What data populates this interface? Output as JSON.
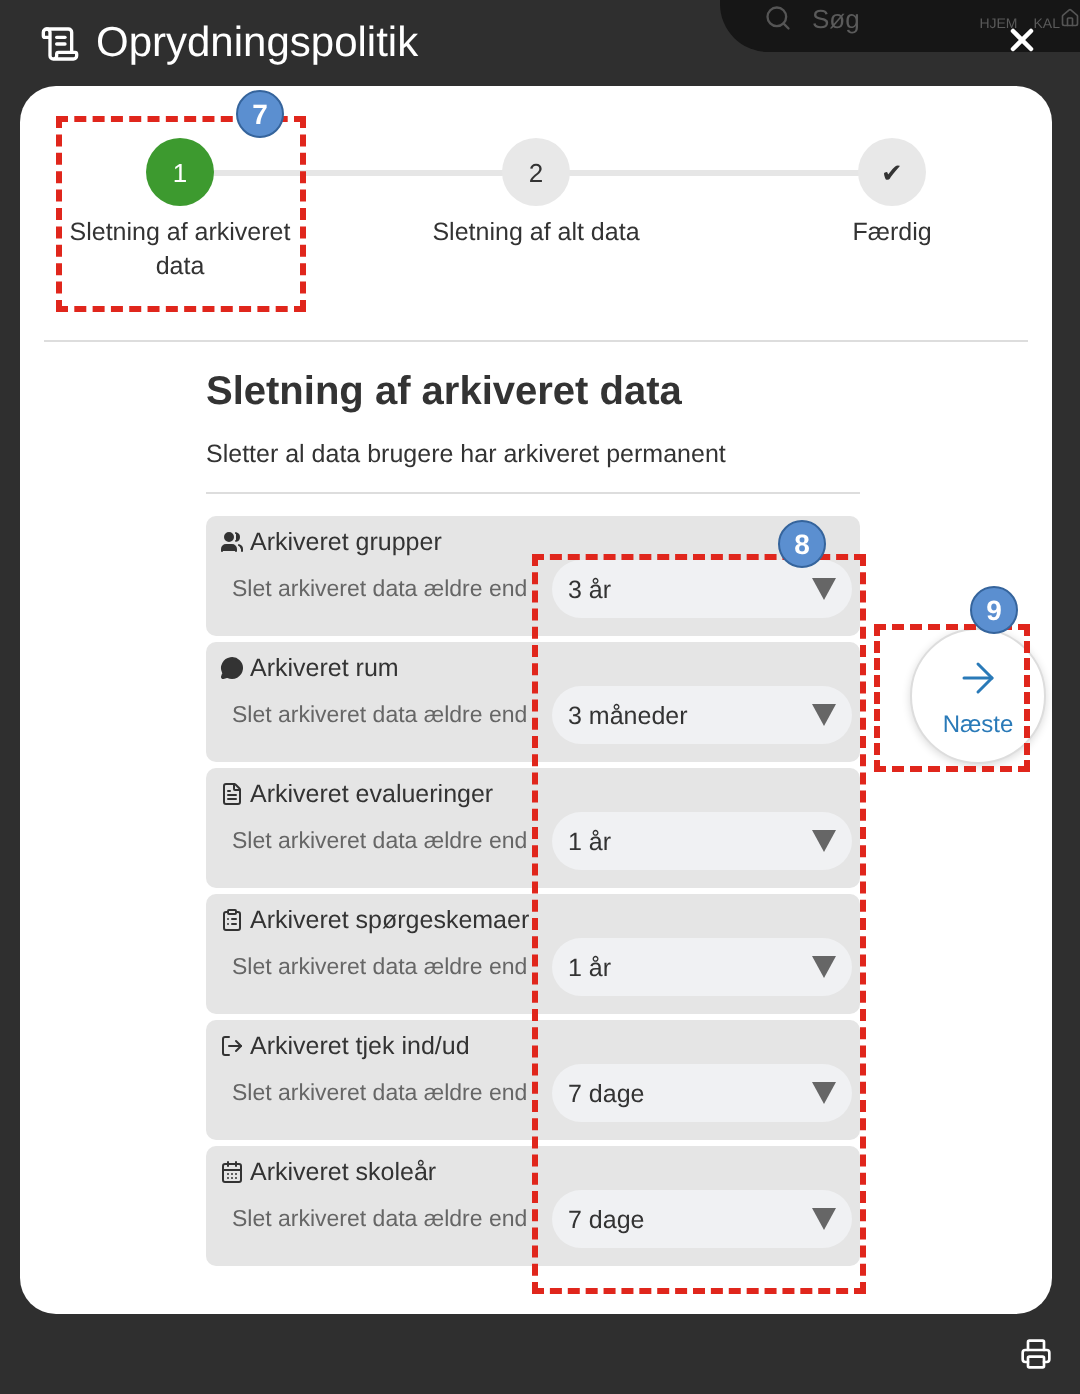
{
  "background": {
    "search": "Søg",
    "nav": [
      "HJEM",
      "KAL"
    ]
  },
  "window": {
    "title": "Oprydningspolitik"
  },
  "steps": [
    {
      "marker": "1",
      "label": "Sletning af arkiveret data",
      "selected": true
    },
    {
      "marker": "2",
      "label": "Sletning af alt data",
      "selected": false
    },
    {
      "marker": "✔",
      "label": "Færdig",
      "selected": false
    }
  ],
  "section": {
    "title": "Sletning af arkiveret data",
    "description": "Sletter al data brugere har arkiveret permanent"
  },
  "rules": [
    {
      "kind": "groups",
      "title": "Arkiveret grupper",
      "label": "Slet arkiveret data ældre end",
      "value": "3 år"
    },
    {
      "kind": "rooms",
      "title": "Arkiveret rum",
      "label": "Slet arkiveret data ældre end",
      "value": "3 måneder"
    },
    {
      "kind": "evaluations",
      "title": "Arkiveret evalueringer",
      "label": "Slet arkiveret data ældre end",
      "value": "1 år"
    },
    {
      "kind": "surveys",
      "title": "Arkiveret spørgeskemaer",
      "label": "Slet arkiveret data ældre end",
      "value": "1 år"
    },
    {
      "kind": "checkin",
      "title": "Arkiveret tjek ind/ud",
      "label": "Slet arkiveret data ældre end",
      "value": "7 dage"
    },
    {
      "kind": "schoolyear",
      "title": "Arkiveret skoleår",
      "label": "Slet arkiveret data ældre end",
      "value": "7 dage"
    }
  ],
  "next_button": {
    "label": "Næste"
  },
  "annotations": [
    "7",
    "8",
    "9"
  ]
}
